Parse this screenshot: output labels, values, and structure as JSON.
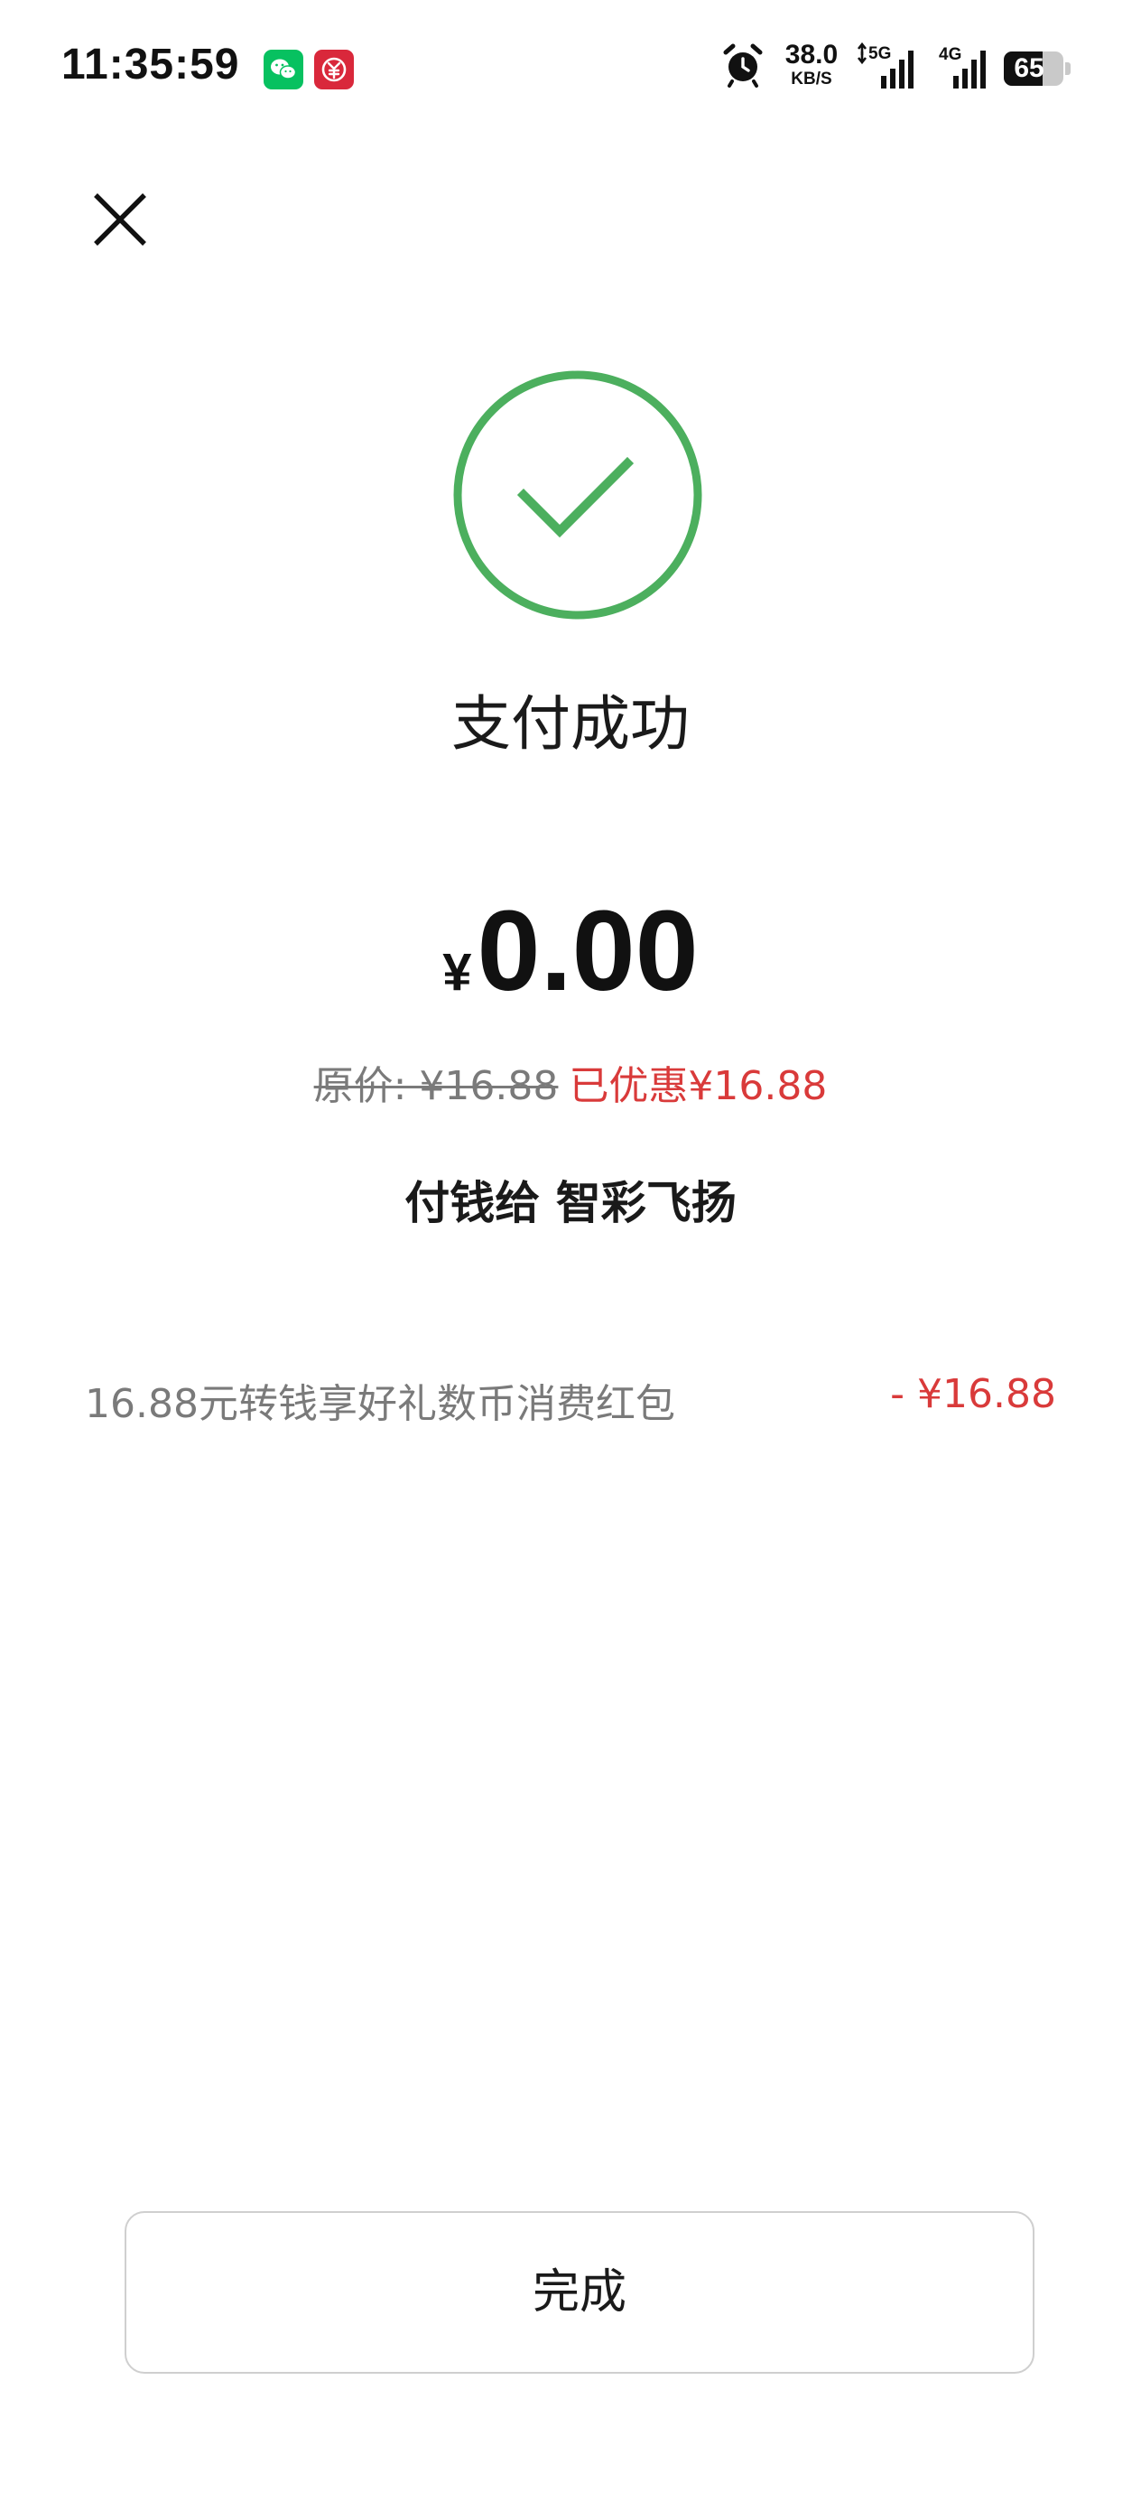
{
  "status_bar": {
    "time": "11:35:59",
    "net_speed_value": "38.0",
    "net_speed_unit": "KB/S",
    "signal_1_label": "5G",
    "signal_2_label": "4G",
    "battery_level": "65",
    "battery_fraction": 0.65,
    "notification_icons": [
      "wechat-icon",
      "digital-rmb-icon"
    ]
  },
  "header": {
    "close_icon": "close-icon"
  },
  "result": {
    "status_icon": "check-circle-icon",
    "title": "支付成功",
    "currency_symbol": "¥",
    "amount": "0.00",
    "original_price": "原价: ¥16.88",
    "discount_text": "已优惠¥16.88",
    "payee": "付钱给 智彩飞扬"
  },
  "details": [
    {
      "label": "16.88元转钱享好礼数币消费红包",
      "amount": "- ¥16.88"
    }
  ],
  "footer": {
    "done_label": "完成"
  },
  "colors": {
    "success_green": "#4caf5e",
    "discount_red": "#d93a3a",
    "muted_gray": "#7a7a7a",
    "wechat_green": "#07c160",
    "ecny_red": "#d9283b"
  }
}
